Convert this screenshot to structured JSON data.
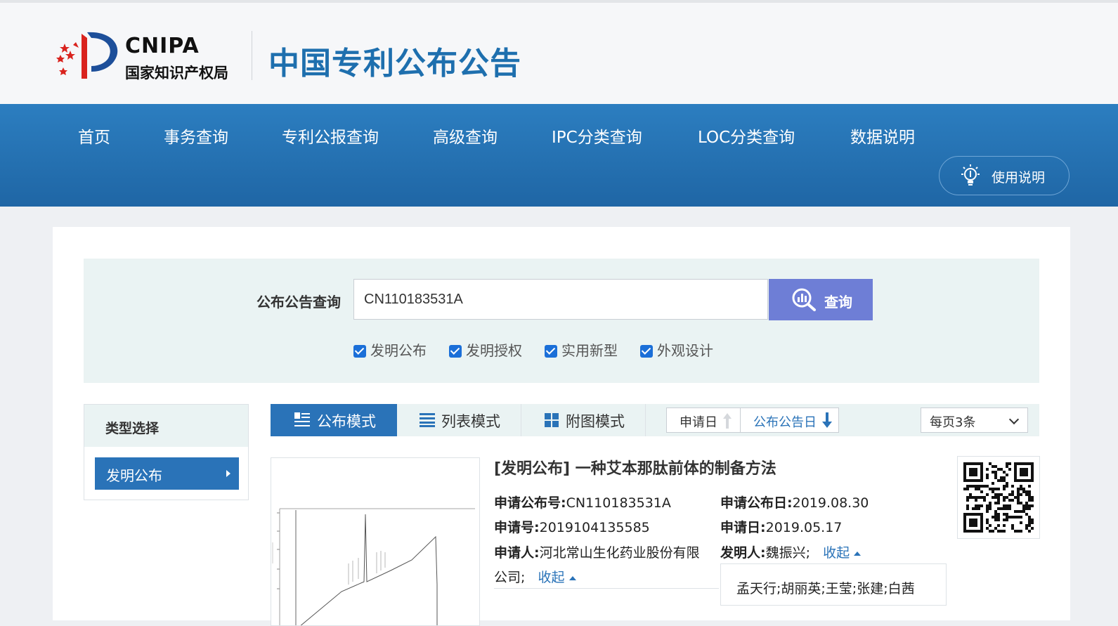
{
  "header": {
    "logo_en": "CNIPA",
    "logo_cn": "国家知识产权局",
    "site_title": "中国专利公布公告"
  },
  "nav": {
    "items": [
      {
        "label": "首页"
      },
      {
        "label": "事务查询"
      },
      {
        "label": "专利公报查询"
      },
      {
        "label": "高级查询"
      },
      {
        "label": "IPC分类查询"
      },
      {
        "label": "LOC分类查询"
      },
      {
        "label": "数据说明"
      }
    ],
    "help_label": "使用说明"
  },
  "search": {
    "label": "公布公告查询",
    "value": "CN110183531A",
    "button_label": "查询",
    "checkboxes": [
      {
        "label": "发明公布",
        "checked": true
      },
      {
        "label": "发明授权",
        "checked": true
      },
      {
        "label": "实用新型",
        "checked": true
      },
      {
        "label": "外观设计",
        "checked": true
      }
    ]
  },
  "sidebar": {
    "title": "类型选择",
    "items": [
      {
        "label": "发明公布"
      }
    ]
  },
  "toolbar": {
    "modes": [
      {
        "label": "公布模式",
        "active": true
      },
      {
        "label": "列表模式",
        "active": false
      },
      {
        "label": "附图模式",
        "active": false
      }
    ],
    "sort": [
      {
        "label": "申请日",
        "direction": "up",
        "active": false
      },
      {
        "label": "公布公告日",
        "direction": "down",
        "active": true
      }
    ],
    "per_page": "每页3条"
  },
  "result": {
    "title": "[发明公布] 一种艾本那肽前体的制备方法",
    "pub_no_label": "申请公布号:",
    "pub_no": "CN110183531A",
    "pub_date_label": "申请公布日:",
    "pub_date": "2019.08.30",
    "app_no_label": "申请号:",
    "app_no": "2019104135585",
    "app_date_label": "申请日:",
    "app_date": "2019.05.17",
    "applicant_label": "申请人:",
    "applicant_line1": "河北常山生化药业股份有限",
    "applicant_line2": "公司;",
    "inventor_label": "发明人:",
    "inventor_first": "魏振兴;",
    "inventor_more": "孟天行;胡丽英;王莹;张建;白茜",
    "collapse_label": "收起"
  },
  "colors": {
    "nav_bg": "#2270b0",
    "title_blue": "#1e6fae",
    "search_btn": "#6e7ed6",
    "checkbox": "#1b6fd8"
  }
}
